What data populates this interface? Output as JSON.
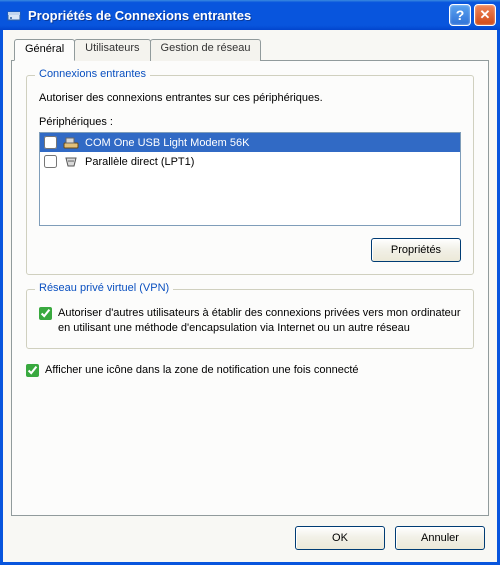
{
  "window": {
    "title": "Propriétés de Connexions entrantes",
    "helpGlyph": "?",
    "closeGlyph": "✕"
  },
  "tabs": {
    "general": "Général",
    "users": "Utilisateurs",
    "network": "Gestion de réseau"
  },
  "group_incoming": {
    "legend": "Connexions entrantes",
    "instruction": "Autoriser des connexions entrantes sur ces périphériques.",
    "devices_label": "Périphériques :",
    "devices": [
      {
        "label": "COM One USB Light Modem 56K",
        "checked": false,
        "selected": true,
        "icon": "modem"
      },
      {
        "label": "Parallèle direct (LPT1)",
        "checked": false,
        "selected": false,
        "icon": "port"
      }
    ],
    "properties_btn": "Propriétés"
  },
  "group_vpn": {
    "legend": "Réseau privé virtuel (VPN)",
    "checkbox_label": "Autoriser d'autres utilisateurs à établir des connexions privées vers mon ordinateur en utilisant une méthode d'encapsulation via Internet ou un autre réseau",
    "checked": true
  },
  "tray_checkbox": {
    "label": "Afficher une icône dans la zone de notification une fois connecté",
    "checked": true
  },
  "buttons": {
    "ok": "OK",
    "cancel": "Annuler"
  }
}
